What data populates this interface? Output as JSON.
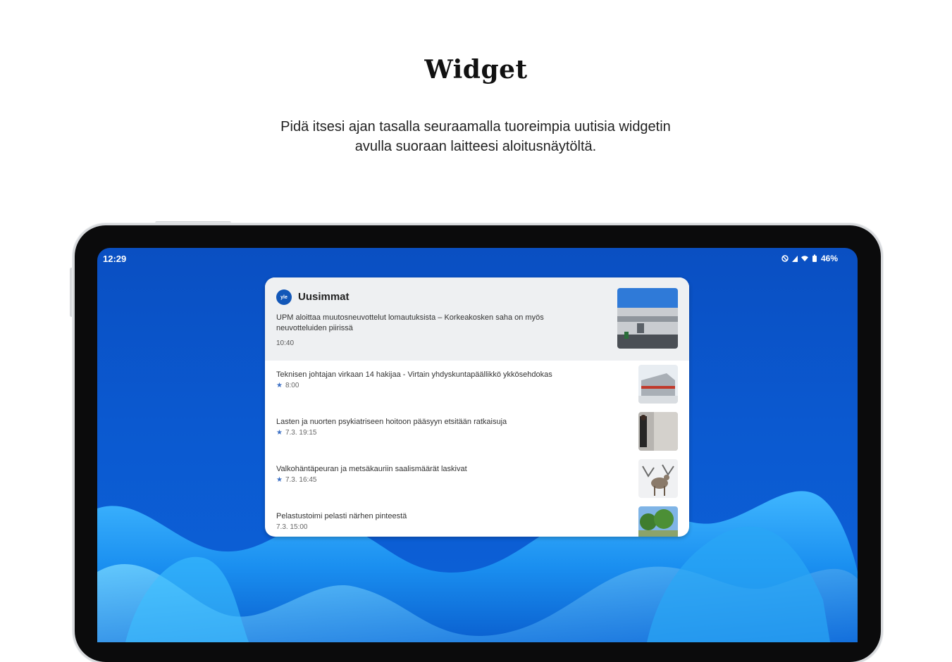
{
  "promo": {
    "title": "Widget",
    "subtitle": "Pidä itsesi ajan tasalla seuraamalla tuoreimpia uutisia widgetin avulla suoraan laitteesi aloitusnäytöltä."
  },
  "status_bar": {
    "time": "12:29",
    "battery": "46%",
    "icons": [
      "do-not-disturb-icon",
      "signal-icon",
      "wifi-icon",
      "battery-icon"
    ]
  },
  "widget": {
    "logo_text": "yle",
    "name": "Uusimmat",
    "top_story": {
      "headline": "UPM aloittaa muutosneuvottelut lomautuksista – Korkeakosken saha on myös neuvotteluiden piirissä",
      "time": "10:40"
    },
    "items": [
      {
        "title": "Teknisen johtajan virkaan 14 hakijaa - Virtain yhdyskuntapäällikkö ykkösehdokas",
        "time": "8:00",
        "starred": true
      },
      {
        "title": "Lasten ja nuorten psykiatriseen hoitoon pääsyyn etsitään ratkaisuja",
        "time": "7.3. 19:15",
        "starred": true
      },
      {
        "title": "Valkohäntäpeuran ja metsäkauriin saalismäärät laskivat",
        "time": "7.3. 16:45",
        "starred": true
      },
      {
        "title": "Pelastustoimi pelasti närhen pinteestä",
        "time": "7.3. 15:00",
        "starred": false
      }
    ]
  },
  "colors": {
    "accent": "#1257b8",
    "wallpaper": "#0b59d0",
    "widget_header_bg": "#eef0f2"
  }
}
